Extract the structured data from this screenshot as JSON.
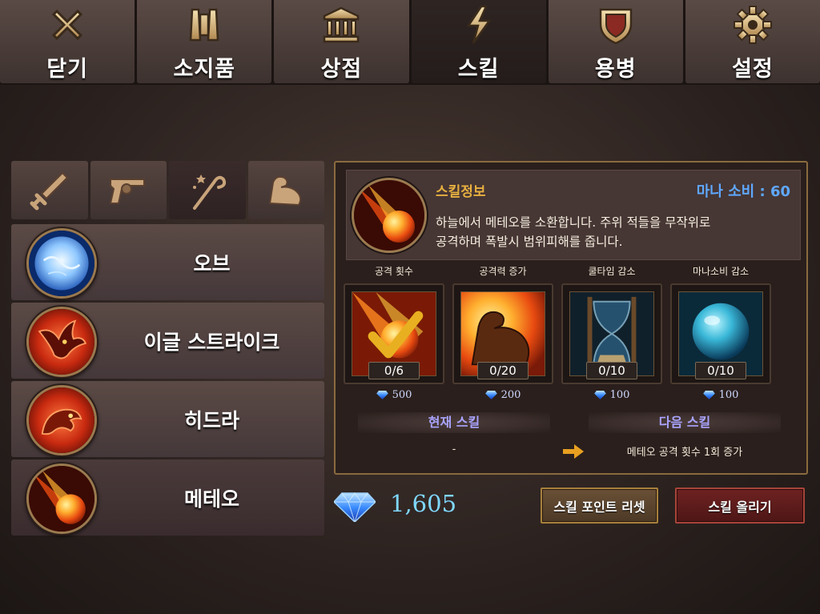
{
  "tabs": [
    {
      "label": "닫기",
      "icon": "close-icon"
    },
    {
      "label": "소지품",
      "icon": "inventory-icon"
    },
    {
      "label": "상점",
      "icon": "shop-icon"
    },
    {
      "label": "스킬",
      "icon": "skill-icon",
      "active": true
    },
    {
      "label": "용병",
      "icon": "mercenary-shield-icon"
    },
    {
      "label": "설정",
      "icon": "gear-icon"
    }
  ],
  "categories": [
    {
      "icon": "sword-icon"
    },
    {
      "icon": "revolver-icon"
    },
    {
      "icon": "magic-staff-icon",
      "active": true
    },
    {
      "icon": "muscle-arm-icon"
    }
  ],
  "skills": [
    {
      "name": "오브",
      "icon": "orb-skill-icon"
    },
    {
      "name": "이글 스트라이크",
      "icon": "eagle-skill-icon"
    },
    {
      "name": "히드라",
      "icon": "hydra-skill-icon"
    },
    {
      "name": "메테오",
      "icon": "meteor-skill-icon",
      "selected": true
    }
  ],
  "detail": {
    "title": "스킬정보",
    "mana": "마나 소비 : 60",
    "description_line1": "하늘에서 메테오를 소환합니다. 주위 적들을 무작위로",
    "description_line2": "공격하며 폭발시 범위피해를 줍니다.",
    "upgrades": [
      {
        "label": "공격 횟수",
        "count": "0/6",
        "cost": "500",
        "icon": "meteor-check-icon"
      },
      {
        "label": "공격력 증가",
        "count": "0/20",
        "cost": "200",
        "icon": "muscle-fire-icon"
      },
      {
        "label": "쿨타임 감소",
        "count": "0/10",
        "cost": "100",
        "icon": "hourglass-icon"
      },
      {
        "label": "마나소비 감소",
        "count": "0/10",
        "cost": "100",
        "icon": "mana-orb-icon"
      }
    ],
    "current_label": "현재 스킬",
    "next_label": "다음 스킬",
    "current_value": "-",
    "next_value": "메테오 공격 횟수 1회 증가"
  },
  "gems": "1,605",
  "buttons": {
    "reset": "스킬 포인트 리셋",
    "upgrade": "스킬 올리기"
  },
  "colors": {
    "gold_title": "#e8b040",
    "mana_blue": "#5fa8ff",
    "gem_cyan": "#7fd7ff",
    "compare_lavender": "#a9a4ff"
  }
}
